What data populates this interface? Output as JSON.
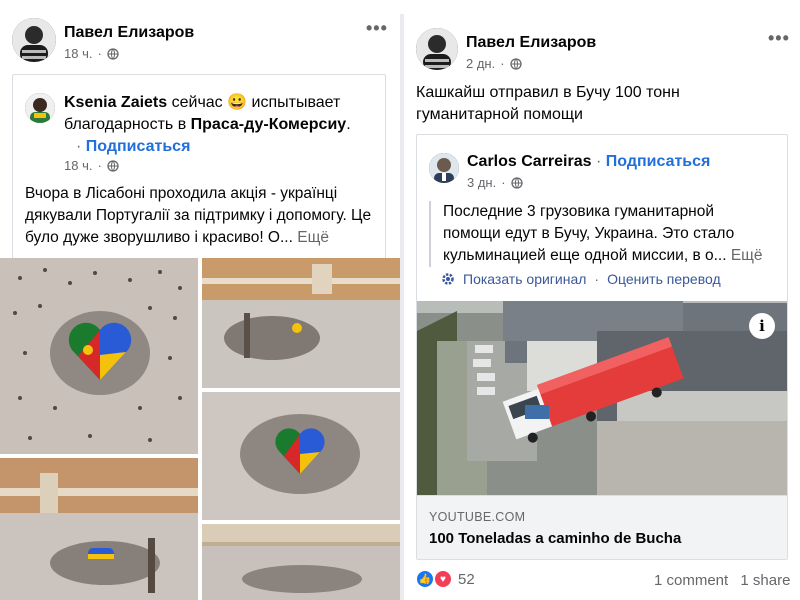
{
  "left_post": {
    "author": "Павел Елизаров",
    "time": "18 ч.",
    "shared": {
      "author": "Ksenia Zaiets",
      "status_prefix": "сейчас",
      "emoji": "😀",
      "status_feeling": "испытывает благодарность в",
      "place": "Праса-ду-Комерсиу",
      "period": ".",
      "dot": "·",
      "subscribe": "Подписаться",
      "time": "18 ч.",
      "body": "Вчора в Лісабоні проходила акція - українці дякували Португалії за підтримку і допомогу. Це було дуже зворушливо і красиво! О...",
      "see_more": "Ещё"
    }
  },
  "right_post": {
    "author": "Павел Елизаров",
    "time": "2 дн.",
    "body": "Кашкайш отправил в Бучу 100 тонн гуманитарной помощи",
    "shared": {
      "author": "Carlos Carreiras",
      "dot": "·",
      "subscribe": "Подписаться",
      "time": "3 дн.",
      "quote": "Последние 3 грузовика гуманитарной помощи едут в Бучу, Украина. Это стало кульминацией еще одной миссии, в о...",
      "see_more": "Ещё",
      "show_original": "Показать оригинал",
      "rate_translation": "Оценить перевод",
      "link_domain": "YOUTUBE.COM",
      "link_title": "100 Toneladas a caminho de Bucha",
      "info_glyph": "i"
    },
    "reactions_count": "52",
    "comments": "1 comment",
    "shares": "1 share"
  },
  "icons": {
    "more": "•••",
    "like": "👍",
    "love": "♥"
  },
  "colors": {
    "link_blue": "#216fdb",
    "secondary_text": "#65676b",
    "like_blue": "#1877f2",
    "love_red": "#f33e58",
    "ukraine_blue": "#2a5bd7",
    "ukraine_yellow": "#f4c20d",
    "portugal_green": "#1a7a2e",
    "portugal_red": "#d62828"
  }
}
